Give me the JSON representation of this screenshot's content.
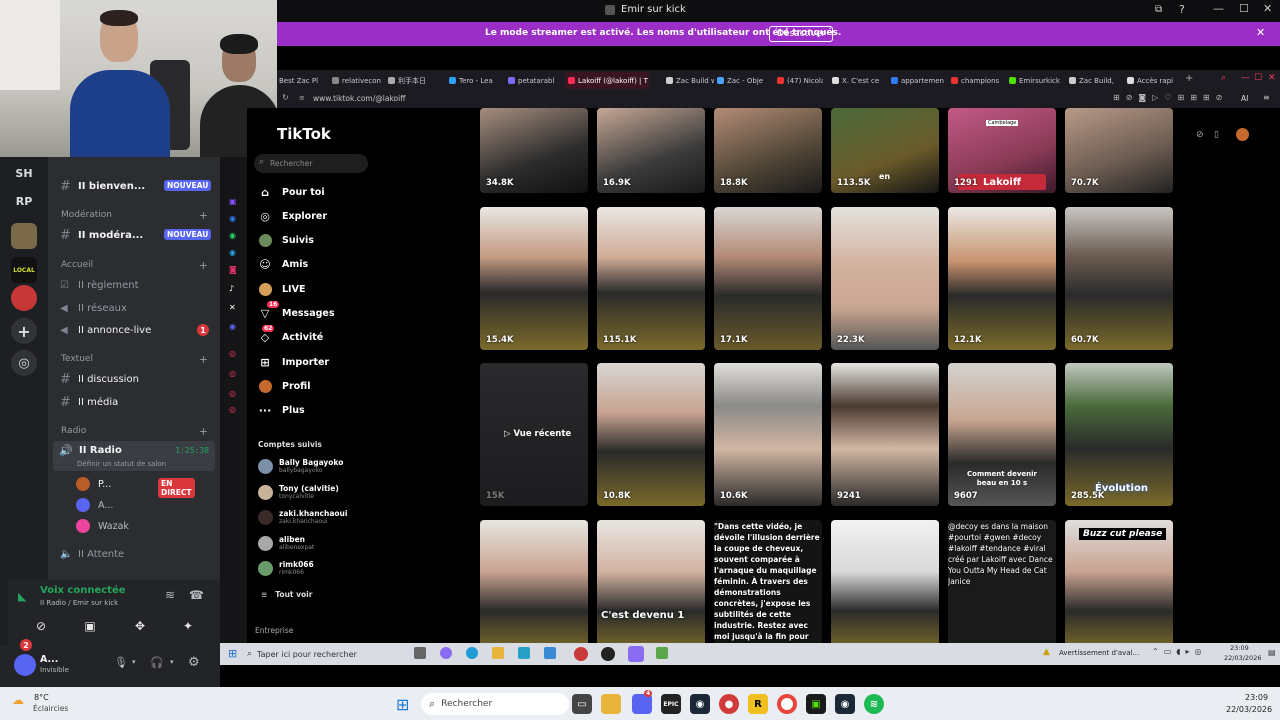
{
  "window": {
    "title": "Emir sur kick",
    "streamer_notice": "Le mode streamer est activé. Les noms d'utilisateur ont été tronqués.",
    "disable_label": "Désactiver"
  },
  "discord": {
    "servers": [
      "SH",
      "RP"
    ],
    "channels": [
      {
        "label": "II bienven...",
        "badge": "NOUVEAU"
      },
      {
        "category": "Modération"
      },
      {
        "label": "II modéra...",
        "badge": "NOUVEAU"
      },
      {
        "category": "Accueil"
      },
      {
        "label": "II règlement"
      },
      {
        "label": "II réseaux"
      },
      {
        "label": "II annonce-live",
        "count": "1"
      },
      {
        "category": "Textuel"
      },
      {
        "label": "II discussion"
      },
      {
        "label": "II média"
      },
      {
        "category": "Radio"
      }
    ],
    "radio": {
      "label": "II Radio",
      "time": "1:25:38",
      "status": "Définir un statut de salon",
      "users": [
        {
          "name": "P...",
          "badge": "EN DIRECT"
        },
        {
          "name": "A..."
        },
        {
          "name": "Wazak"
        }
      ]
    },
    "waiting": "II Attente",
    "voice": {
      "status": "Voix connectée",
      "location": "II Radio / Emir sur kick"
    },
    "user": {
      "name": "A...",
      "status": "Invisible",
      "notif": "2"
    }
  },
  "browser": {
    "tabs": [
      "Best Zac Pl",
      "relativecon",
      "利手本日",
      "Tero - Lea",
      "petatarabl",
      "Lakoiff (@lakoiff) | T",
      "Zac Build w",
      "Zac - Obje",
      "(47) Nicola",
      "X. C'est ce",
      "appartemen",
      "champions",
      "Emirsurkick",
      "Zac Build, ",
      "Accès rapi"
    ],
    "url": "www.tiktok.com/@lakoiff",
    "ext_label": "AI"
  },
  "tiktok": {
    "logo": "TikTok",
    "search_placeholder": "Rechercher",
    "nav": [
      "Pour toi",
      "Explorer",
      "Suivis",
      "Amis",
      "LIVE",
      "Messages",
      "Activité",
      "Importer",
      "Profil",
      "Plus"
    ],
    "messages_badge": "16",
    "activity_badge": "62",
    "followed_title": "Comptes suivis",
    "accounts": [
      {
        "name": "Bally Bagayoko",
        "handle": "ballybagayoko"
      },
      {
        "name": "Tony (calvitie)",
        "handle": "tonycalvitie"
      },
      {
        "name": "zaki.khanchaoui",
        "handle": "zaki.khanchaoui"
      },
      {
        "name": "aliben",
        "handle": "alibenexpat"
      },
      {
        "name": "rimk066",
        "handle": "rimk066"
      }
    ],
    "see_all": "Tout voir",
    "footer": "Entreprise",
    "videos_row1": [
      "34.8K",
      "16.9K",
      "18.8K",
      "113.5K",
      "1291",
      "70.7K"
    ],
    "row1_caption": "en",
    "overlay_lakoiff": "Lakoiff",
    "overlay_sticker": "Cambelage",
    "videos_row2": [
      "15.4K",
      "115.1K",
      "17.1K",
      "22.3K",
      "12.1K",
      "60.7K"
    ],
    "videos_row3": [
      "15K",
      "10.8K",
      "10.6K",
      "9241",
      "9607",
      "285.5K"
    ],
    "seen_recently": "Vue récente",
    "row3_caption5": "Comment devenir beau en 10 s",
    "row3_caption6": "Évolution",
    "row4_caption2": "C'est devenu 1",
    "row4_text3": "\"Dans cette vidéo, je dévoile l'illusion derrière la coupe de cheveux, souvent comparée à l'arnaque du maquillage féminin. À travers des démonstrations concrètes, j'expose les subtilités de cette industrie. Restez avec moi jusqu'à la fin pour déconstruire ensemble cette escroquerie et...",
    "row4_text5": "@decoy es dans la maison #pourtoi #gwen #decoy #lakoiff #tendance #viral créé par Lakoiff avec Dance You Outta My Head de Cat Janice",
    "row4_caption6": "Buzz cut please"
  },
  "taskbar_inner": {
    "search": "Taper ici pour rechercher",
    "notice": "Avertissement d'aval...",
    "time": "23:09",
    "date": "22/03/2026"
  },
  "taskbar": {
    "weather_temp": "8°C",
    "weather_desc": "Éclaircies",
    "search": "Rechercher",
    "time": "23:09",
    "date": "22/03/2026",
    "discord_badge": "4"
  }
}
